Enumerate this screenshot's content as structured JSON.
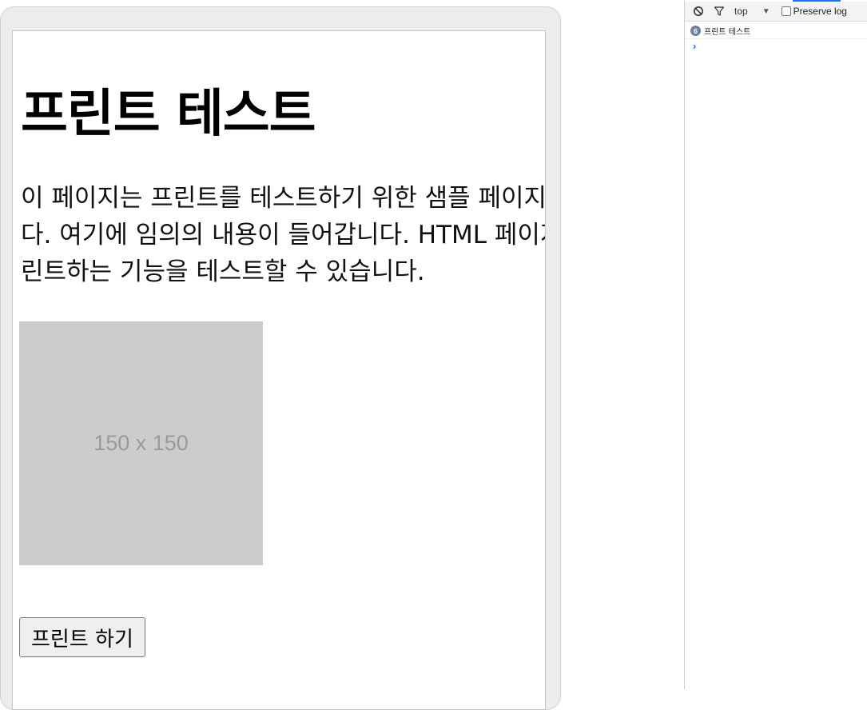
{
  "page": {
    "title": "프린트 테스트",
    "paragraph_lines": [
      "이 페이지는 프린트를 테스트하기 위한 샘플 페이지입니",
      "다. 여기에 임의의 내용이 들어갑니다. HTML 페이지를 프",
      "린트하는 기능을 테스트할 수 있습니다."
    ],
    "image_placeholder_text": "150 x 150",
    "print_button_label": "프린트 하기"
  },
  "devtools": {
    "toolbar": {
      "context": "top",
      "context_arrow": "▼",
      "preserve_log_label": "Preserve log"
    },
    "message": {
      "count": "6",
      "text": "프린트 테스트"
    },
    "prompt": "›",
    "icons": [
      "clear-console-icon",
      "filter-icon",
      "dropdown-arrow-icon",
      "prompt-icon"
    ],
    "colors": {
      "accent": "#1a73e8",
      "badge": "#6d7fa0"
    }
  }
}
